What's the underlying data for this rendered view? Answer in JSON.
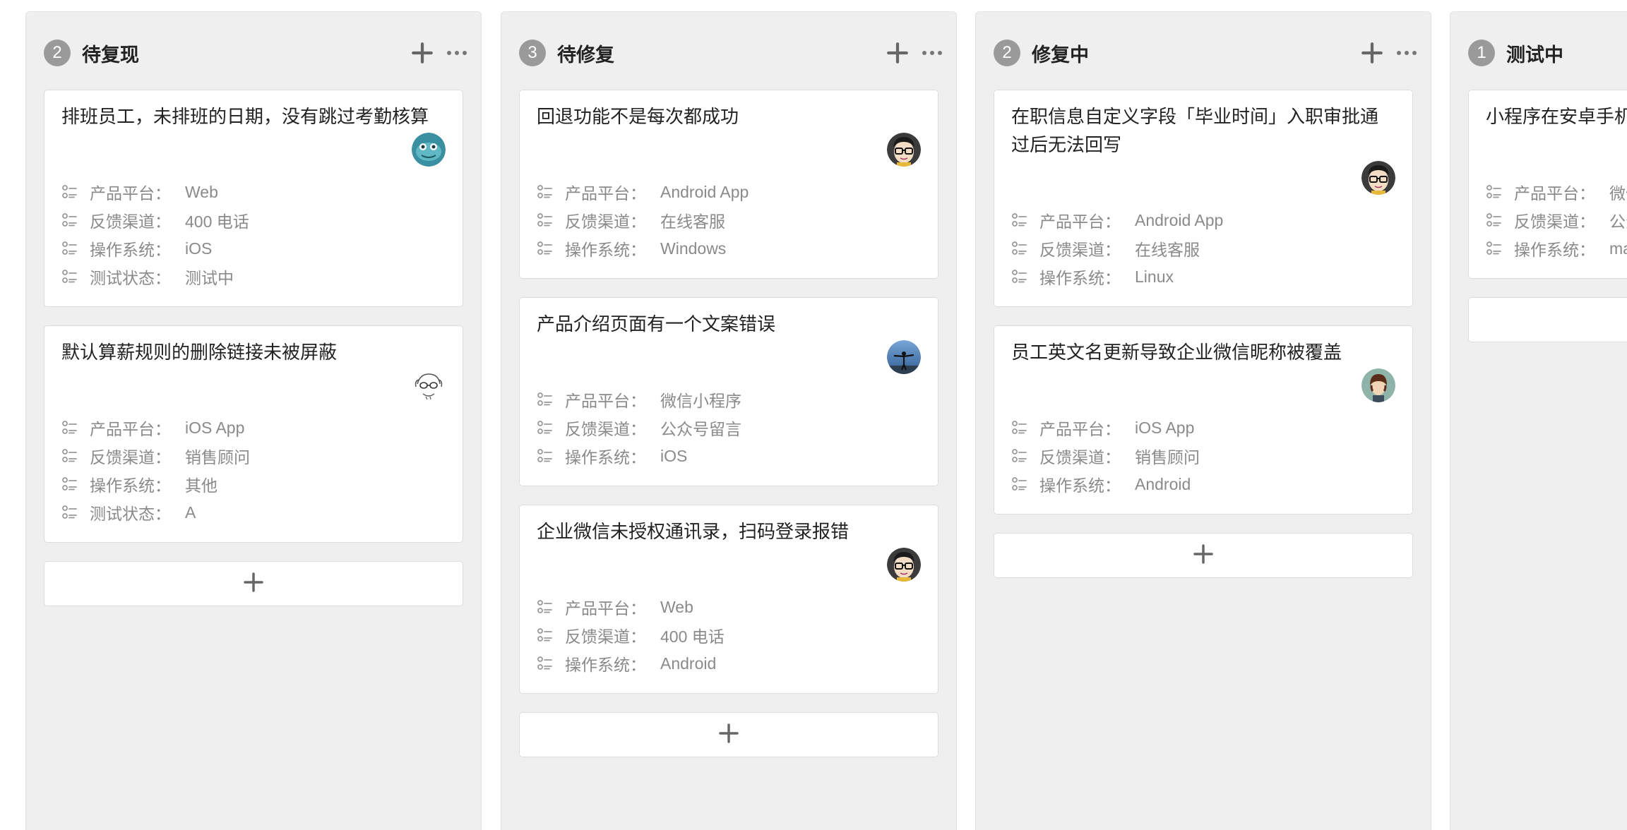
{
  "columns": [
    {
      "count": "2",
      "title": "待复现",
      "cards": [
        {
          "title": "排班员工，未排班的日期，没有跳过考勤核算",
          "avatar": "fish-avatar",
          "fields": [
            {
              "label": "产品平台",
              "value": "Web"
            },
            {
              "label": "反馈渠道",
              "value": "400 电话"
            },
            {
              "label": "操作系统",
              "value": "iOS"
            },
            {
              "label": "测试状态",
              "value": "测试中"
            }
          ]
        },
        {
          "title": "默认算薪规则的删除链接未被屏蔽",
          "avatar": "sketch-avatar",
          "fields": [
            {
              "label": "产品平台",
              "value": "iOS App"
            },
            {
              "label": "反馈渠道",
              "value": "销售顾问"
            },
            {
              "label": "操作系统",
              "value": "其他"
            },
            {
              "label": "测试状态",
              "value": "A"
            }
          ]
        }
      ]
    },
    {
      "count": "3",
      "title": "待修复",
      "cards": [
        {
          "title": "回退功能不是每次都成功",
          "avatar": "glasses-avatar",
          "fields": [
            {
              "label": "产品平台",
              "value": "Android App"
            },
            {
              "label": "反馈渠道",
              "value": "在线客服"
            },
            {
              "label": "操作系统",
              "value": "Windows"
            }
          ]
        },
        {
          "title": "产品介绍页面有一个文案错误",
          "avatar": "sky-avatar",
          "fields": [
            {
              "label": "产品平台",
              "value": "微信小程序"
            },
            {
              "label": "反馈渠道",
              "value": "公众号留言"
            },
            {
              "label": "操作系统",
              "value": "iOS"
            }
          ]
        },
        {
          "title": "企业微信未授权通讯录，扫码登录报错",
          "avatar": "glasses-avatar",
          "fields": [
            {
              "label": "产品平台",
              "value": "Web"
            },
            {
              "label": "反馈渠道",
              "value": "400 电话"
            },
            {
              "label": "操作系统",
              "value": "Android"
            }
          ]
        }
      ]
    },
    {
      "count": "2",
      "title": "修复中",
      "cards": [
        {
          "title": "在职信息自定义字段「毕业时间」入职审批通过后无法回写",
          "avatar": "glasses-avatar",
          "fields": [
            {
              "label": "产品平台",
              "value": "Android App"
            },
            {
              "label": "反馈渠道",
              "value": "在线客服"
            },
            {
              "label": "操作系统",
              "value": "Linux"
            }
          ]
        },
        {
          "title": "员工英文名更新导致企业微信昵称被覆盖",
          "avatar": "hair-avatar",
          "fields": [
            {
              "label": "产品平台",
              "value": "iOS App"
            },
            {
              "label": "反馈渠道",
              "value": "销售顾问"
            },
            {
              "label": "操作系统",
              "value": "Android"
            }
          ]
        }
      ]
    },
    {
      "count": "1",
      "title": "测试中",
      "cards": [
        {
          "title": "小程序在安卓手机",
          "avatar": "",
          "fields": [
            {
              "label": "产品平台",
              "value": "微信"
            },
            {
              "label": "反馈渠道",
              "value": "公众"
            },
            {
              "label": "操作系统",
              "value": "ma"
            }
          ]
        }
      ]
    }
  ],
  "ui": {
    "field_separator": "：",
    "icons": {
      "add": "plus-icon",
      "more": "more-icon",
      "field": "field-list-icon"
    },
    "colors": {
      "column_bg": "#efefef",
      "badge": "#9a9a9a",
      "muted_text": "#8a8a8a",
      "title_text": "#222222"
    }
  }
}
